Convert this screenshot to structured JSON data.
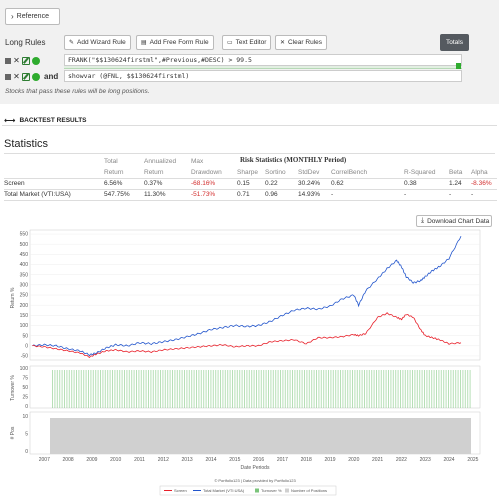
{
  "toolbar": {
    "reference_label": "Reference",
    "long_rules_title": "Long Rules",
    "add_wizard_rule": "Add Wizard Rule",
    "add_free_form_rule": "Add Free Form Rule",
    "text_editor": "Text Editor",
    "clear_rules": "Clear Rules",
    "totals": "Totals"
  },
  "rules": [
    {
      "formula": "FRANK(\"$$130624firstml\",#Previous,#DESC) > 99.5"
    },
    {
      "connector": "and",
      "formula": "showvar (@FNL, $$130624firstml)"
    }
  ],
  "rules_helper": "Stocks that pass these rules will be long positions.",
  "backtest_header": "BACKTEST RESULTS",
  "statistics": {
    "title": "Statistics",
    "risk_header": "Risk Statistics (MONTHLY Period)",
    "col_top": [
      "Total",
      "Annualized",
      "Max"
    ],
    "col_bottom": [
      "Return",
      "Return",
      "Drawdown",
      "Sharpe",
      "Sortino",
      "StdDev",
      "CorrelBench",
      "R-Squared",
      "Beta",
      "Alpha"
    ],
    "rows": [
      {
        "name": "Screen",
        "values": [
          "6.56%",
          "0.37%",
          "-68.16%",
          "0.15",
          "0.22",
          "30.24%",
          "0.62",
          "0.38",
          "1.24",
          "-8.36%"
        ]
      },
      {
        "name": "Total Market (VTI:USA)",
        "values": [
          "547.75%",
          "11.30%",
          "-51.73%",
          "0.71",
          "0.96",
          "14.93%",
          "-",
          "-",
          "-",
          "-"
        ]
      }
    ],
    "negative_color": "#d32f2f"
  },
  "chart": {
    "download_label": "Download Chart Data",
    "ylabel_return": "Return %",
    "ylabel_turnover": "Turnover %",
    "ylabel_pos": "# Pos",
    "xlabel": "Date Periods",
    "credit": "© Portfolio123 | Data provided by Portfolio123",
    "legend": [
      "Screen",
      "Total Market (VTI:USA)",
      "Turnover %",
      "Number of Positions"
    ],
    "colors": {
      "screen": "#e8202a",
      "market": "#2255cc",
      "turnover": "#7bc47b",
      "positions": "#d0d0d0"
    }
  },
  "chart_data": {
    "type": "line",
    "x_ticks": [
      "2007",
      "2008",
      "2009",
      "2010",
      "2011",
      "2012",
      "2013",
      "2014",
      "2015",
      "2016",
      "2017",
      "2018",
      "2019",
      "2020",
      "2021",
      "2022",
      "2023",
      "2024",
      "2025"
    ],
    "y_ticks": [
      550,
      500,
      450,
      400,
      350,
      300,
      250,
      200,
      150,
      100,
      50,
      0,
      -50
    ],
    "ylim": [
      -60,
      560
    ],
    "turnover_ticks": [
      100,
      75,
      50,
      25,
      0
    ],
    "positions_ticks": [
      10,
      5,
      0
    ],
    "series": [
      {
        "name": "Screen",
        "x": [
          2006.5,
          2007.0,
          2007.5,
          2008.0,
          2008.5,
          2008.9,
          2009.2,
          2009.6,
          2010.0,
          2010.5,
          2011.0,
          2011.5,
          2012.0,
          2012.5,
          2013.0,
          2013.5,
          2014.0,
          2014.5,
          2015.0,
          2015.5,
          2016.0,
          2016.5,
          2017.0,
          2017.5,
          2018.0,
          2018.5,
          2019.0,
          2019.5,
          2020.0,
          2020.2,
          2020.5,
          2021.0,
          2021.4,
          2021.8,
          2022.0,
          2022.2,
          2022.5,
          2022.8,
          2023.0,
          2023.3,
          2023.6,
          2024.0,
          2024.5
        ],
        "y": [
          0,
          -5,
          -15,
          -25,
          -35,
          -55,
          -40,
          -25,
          -20,
          -30,
          -25,
          -30,
          -20,
          -15,
          -10,
          -5,
          0,
          5,
          -5,
          0,
          0,
          20,
          25,
          30,
          10,
          40,
          40,
          45,
          55,
          50,
          60,
          140,
          160,
          140,
          130,
          155,
          140,
          80,
          50,
          40,
          30,
          10,
          15
        ]
      },
      {
        "name": "Total Market (VTI:USA)",
        "x": [
          2006.5,
          2007.0,
          2007.5,
          2008.0,
          2008.5,
          2008.9,
          2009.2,
          2009.6,
          2010.0,
          2010.5,
          2011.0,
          2011.5,
          2012.0,
          2012.5,
          2013.0,
          2013.5,
          2014.0,
          2014.5,
          2015.0,
          2015.5,
          2016.0,
          2016.5,
          2017.0,
          2017.5,
          2018.0,
          2018.5,
          2019.0,
          2019.5,
          2020.0,
          2020.2,
          2020.5,
          2021.0,
          2021.4,
          2021.8,
          2022.0,
          2022.2,
          2022.5,
          2022.8,
          2023.0,
          2023.3,
          2023.6,
          2024.0,
          2024.5
        ],
        "y": [
          0,
          5,
          0,
          -15,
          -25,
          -45,
          -35,
          -10,
          5,
          0,
          15,
          10,
          20,
          30,
          45,
          60,
          80,
          90,
          100,
          95,
          100,
          120,
          150,
          175,
          185,
          180,
          195,
          230,
          250,
          200,
          270,
          330,
          380,
          420,
          390,
          340,
          310,
          320,
          340,
          370,
          390,
          430,
          540
        ]
      }
    ]
  }
}
